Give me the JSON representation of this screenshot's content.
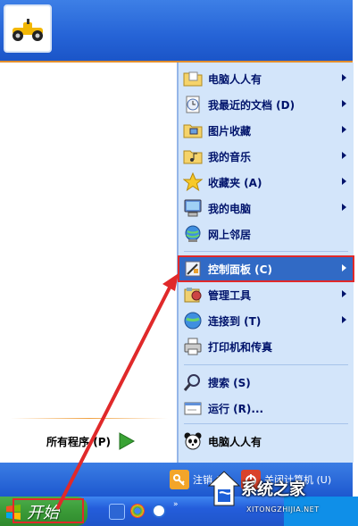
{
  "menu": {
    "right_items": [
      {
        "label": "电脑人人有",
        "icon": "folder-documents-icon",
        "arrow": true
      },
      {
        "label": "我最近的文档 (D)",
        "icon": "recent-documents-icon",
        "arrow": true
      },
      {
        "label": "图片收藏",
        "icon": "folder-pictures-icon",
        "arrow": true
      },
      {
        "label": "我的音乐",
        "icon": "folder-music-icon",
        "arrow": true
      },
      {
        "label": "收藏夹 (A)",
        "icon": "star-favorites-icon",
        "arrow": true
      },
      {
        "label": "我的电脑",
        "icon": "my-computer-icon",
        "arrow": true
      },
      {
        "label": "网上邻居",
        "icon": "network-places-icon",
        "arrow": false
      },
      {
        "label": "控制面板 (C)",
        "icon": "control-panel-icon",
        "arrow": true,
        "selected": true
      },
      {
        "label": "管理工具",
        "icon": "admin-tools-icon",
        "arrow": true
      },
      {
        "label": "连接到 (T)",
        "icon": "connect-to-icon",
        "arrow": true
      },
      {
        "label": "打印机和传真",
        "icon": "printer-icon",
        "arrow": false
      },
      {
        "label": "搜索 (S)",
        "icon": "search-icon",
        "arrow": false
      },
      {
        "label": "运行 (R)...",
        "icon": "run-icon",
        "arrow": false
      },
      {
        "label": "电脑人人有",
        "icon": "panda-icon",
        "arrow": false
      }
    ],
    "all_programs": "所有程序 (P)",
    "logoff": "注销 (L)",
    "shutdown": "关闭计算机 (U)"
  },
  "taskbar": {
    "start_label": "开始"
  },
  "watermark": {
    "title": "系统之家",
    "subtitle": "XITONGZHIJIA.NET"
  },
  "colors": {
    "selection": "#316ac5",
    "highlight_box": "#e0292a",
    "start_green": "#3a9a37",
    "menu_blue": "#2563d6",
    "right_pane": "#d3e5fa"
  }
}
